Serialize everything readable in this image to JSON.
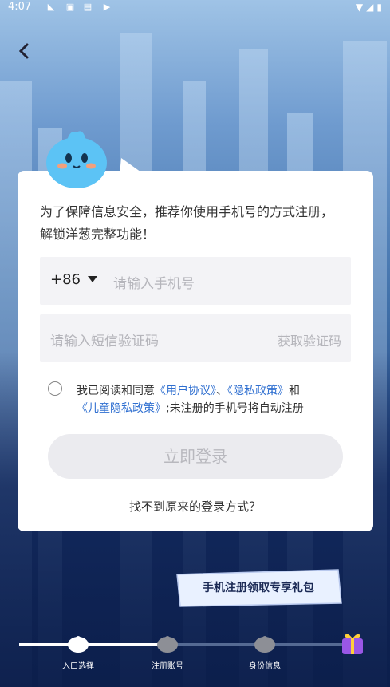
{
  "status_bar": {
    "time": "4:07"
  },
  "intro": {
    "text": "为了保障信息安全，推荐你使用手机号的方式注册，解锁洋葱完整功能！"
  },
  "phone": {
    "country_code": "+86",
    "placeholder": "请输入手机号"
  },
  "code": {
    "placeholder": "请输入短信验证码",
    "get_code": "获取验证码"
  },
  "agreement": {
    "prefix": "我已阅读和同意",
    "user_agreement": "《用户协议》",
    "sep": "、",
    "privacy": "《隐私政策》",
    "and": "和",
    "child_privacy": "《儿童隐私政策》",
    "suffix": ";未注册的手机号将自动注册"
  },
  "login_button": "立即登录",
  "lost_login": "找不到原来的登录方式？",
  "promo": "手机注册领取专享礼包",
  "steps": [
    {
      "label": "入口选择",
      "state": "done"
    },
    {
      "label": "注册账号",
      "state": "pending"
    },
    {
      "label": "身份信息",
      "state": "pending"
    }
  ],
  "progress": {
    "fraction": 0.42
  },
  "colors": {
    "link": "#2f6fd0",
    "card": "#ffffff",
    "background": "#1f3f7a"
  }
}
